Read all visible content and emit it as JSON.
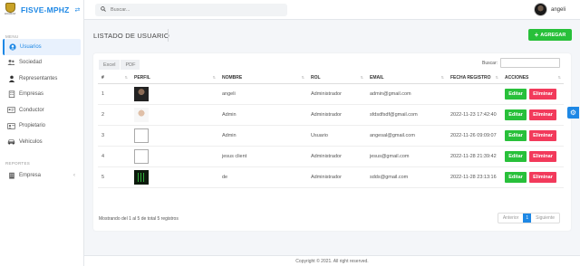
{
  "brand": {
    "title": "FISVE-MPHZ",
    "logo_caption": "HUARAZ"
  },
  "topbar": {
    "search_placeholder": "Buscar...",
    "user_name": "angeli"
  },
  "sidebar": {
    "menu_label": "MENU",
    "items": [
      {
        "label": "Usuarios",
        "icon": "user-circle-icon",
        "active": true
      },
      {
        "label": "Sociedad",
        "icon": "people-icon"
      },
      {
        "label": "Representantes",
        "icon": "person-icon"
      },
      {
        "label": "Empresas",
        "icon": "building-icon"
      },
      {
        "label": "Conductor",
        "icon": "id-card-icon"
      },
      {
        "label": "Propietario",
        "icon": "address-card-icon"
      },
      {
        "label": "Vehiculos",
        "icon": "car-icon"
      }
    ],
    "reports_label": "REPORTES",
    "reports_items": [
      {
        "label": "Empresa",
        "icon": "building-icon"
      }
    ]
  },
  "page": {
    "title": "LISTADO DE USUARIO",
    "add_button": "AGREGAR"
  },
  "table": {
    "export_buttons": [
      "Excel",
      "PDF"
    ],
    "filter_label": "Buscar:",
    "headers": [
      "#",
      "PERFIL",
      "NOMBRE",
      "ROL",
      "EMAIL",
      "FECHA REGISTRO",
      "ACCIONES"
    ],
    "edit_label": "Editar",
    "delete_label": "Eliminar",
    "rows": [
      {
        "id": "1",
        "name": "angeli",
        "role": "Administrador",
        "email": "admin@gmail.com",
        "date": ""
      },
      {
        "id": "2",
        "name": "Admin",
        "role": "Administrador",
        "email": "sfdsdfsdf@gmail.com",
        "date": "2022-11-23 17:42:40"
      },
      {
        "id": "3",
        "name": "Admin",
        "role": "Usuario",
        "email": "angesal@gmail.com",
        "date": "2022-11-26 09:09:07"
      },
      {
        "id": "4",
        "name": "jesus client",
        "role": "Administrador",
        "email": "jesus@gmail.com",
        "date": "2022-11-28 21:39:42"
      },
      {
        "id": "5",
        "name": "de",
        "role": "Administrador",
        "email": "sdds@gmail.com",
        "date": "2022-11-28 23:13:16"
      }
    ],
    "info": "Mostrando del 1 al 5 de total 5 registros",
    "pagination": {
      "prev": "Anterior",
      "current": "1",
      "next": "Siguiente"
    }
  },
  "footer": {
    "text": "Copyright © 2021. All right reserved."
  },
  "colors": {
    "primary": "#1e88e5",
    "success": "#28c03a",
    "danger": "#f23a5b"
  }
}
